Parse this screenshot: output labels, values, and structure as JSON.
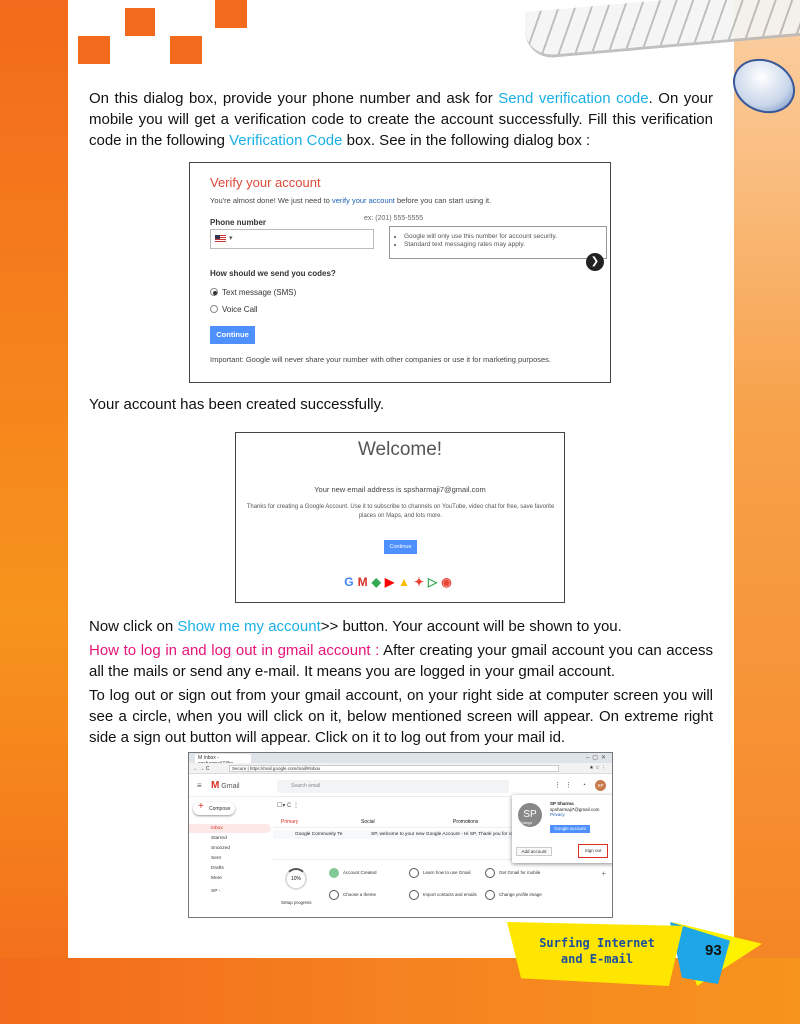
{
  "para1": {
    "t1": "On this dialog box, provide your phone number and ask for ",
    "h1": "Send verification code",
    "t2": ". On your mobile you will get a verification code to create the account successfully. Fill this verification code in the following ",
    "h2": "Verification Code",
    "t3": " box. See in the following dialog box :"
  },
  "verify": {
    "title": "Verify your account",
    "sub_pre": "You're almost done! We just need to ",
    "sub_link": "verify your account",
    "sub_post": " before you can start using it.",
    "phone_label": "Phone number",
    "phone_hint": "ex: (201) 555-5555",
    "flag_caret": "▾",
    "tip1": "Google will only use this number for account security.",
    "tip2": "Standard text messaging rates may apply.",
    "method_label": "How should we send you codes?",
    "opt_sms": "Text message (SMS)",
    "opt_voice": "Voice Call",
    "continue": "Continue",
    "footer": "Important: Google will never share your number with other companies or use it for marketing purposes."
  },
  "para2": "Your account has been created successfully.",
  "welcome": {
    "title": "Welcome!",
    "email": "Your new email address is spsharmaji7@gmail.com",
    "body": "Thanks for creating a Google Account. Use it to subscribe to channels on YouTube, video chat for free, save favorite places on Maps, and lots more.",
    "continue": "Continue",
    "icons": "G M ◆ ▶ ▲ ✦ ▷ ◉"
  },
  "para3": {
    "t1": "Now click on ",
    "h1": "Show me my account",
    "t2": ">> button. Your account will be shown to you."
  },
  "para4": {
    "h1": "How to log in and log out in gmail account :",
    "t1": " After creating your gmail account you can access all the mails or send any e-mail. It means you are logged in your gmail account."
  },
  "para5": "To log out or sign out from your gmail account, on your right side at computer screen you will see a circle, when you will click on it, below mentioned screen will appear. On extreme right side a sign out button will appear. Click on it to log out from your mail id.",
  "gmail": {
    "tab": "M Inbox - spsharmaji7@g",
    "url": "Secure | https://mail.google.com/mail/#inbox",
    "logo": "Gmail",
    "search": "Search email",
    "compose": "Compose",
    "nav": [
      "Inbox",
      "Starred",
      "Snoozed",
      "Sent",
      "Drafts",
      "More"
    ],
    "user_short": "SP -",
    "tabs": [
      "Primary",
      "Social",
      "Promotions"
    ],
    "row_from": "Google Community Te",
    "row_subject": "SP, welcome to your new Google Account - Hi SP, Thank you for creat",
    "progress": "10%",
    "setup_progress": "Setup progress",
    "setup_items": [
      "Account Created",
      "Learn how to use Gmail",
      "Get Gmail for mobile",
      "Choose a theme",
      "Import contacts and emails",
      "Change profile image"
    ],
    "acct_name": "SP Sharma",
    "acct_email": "spsharmaji7@gmail.com",
    "acct_privacy": "Privacy",
    "acct_initials": "SP",
    "acct_change": "Change",
    "my_account": "Google account",
    "add_account": "Add account",
    "sign_out": "Sign out"
  },
  "footer": {
    "badge_line1": "Surfing Internet",
    "badge_line2": "and E-mail",
    "page_number": "93"
  },
  "colors": {
    "orange": "#f26a1b",
    "highlight_blue": "#1ab0e6",
    "highlight_pink": "#e5157a",
    "badge_yellow": "#ffe600"
  }
}
